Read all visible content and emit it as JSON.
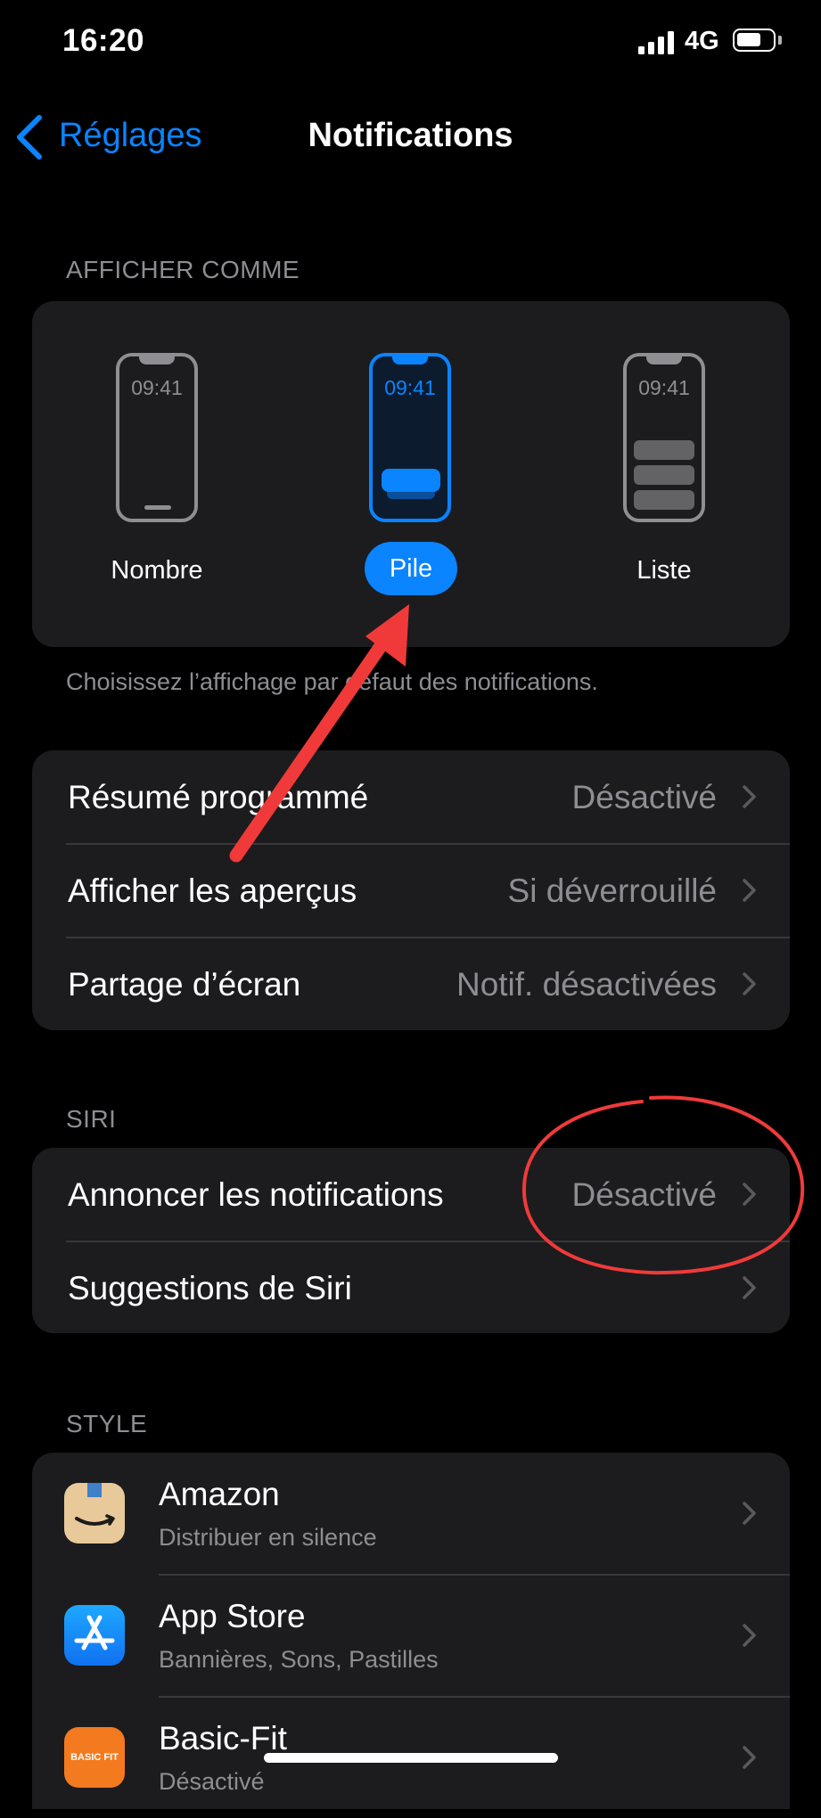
{
  "status": {
    "time": "16:20",
    "network": "4G"
  },
  "nav": {
    "back_label": "Réglages",
    "title": "Notifications"
  },
  "display_section": {
    "header": "AFFICHER COMME",
    "phone_time": "09:41",
    "options": [
      {
        "label": "Nombre",
        "selected": false
      },
      {
        "label": "Pile",
        "selected": true
      },
      {
        "label": "Liste",
        "selected": false
      }
    ],
    "footer": "Choisissez l’affichage par défaut des notifications."
  },
  "settings_rows": [
    {
      "label": "Résumé programmé",
      "value": "Désactivé"
    },
    {
      "label": "Afficher les aperçus",
      "value": "Si déverrouillé"
    },
    {
      "label": "Partage d’écran",
      "value": "Notif. désactivées"
    }
  ],
  "siri_section": {
    "header": "SIRI",
    "rows": [
      {
        "label": "Annoncer les notifications",
        "value": "Désactivé"
      },
      {
        "label": "Suggestions de Siri",
        "value": ""
      }
    ]
  },
  "style_section": {
    "header": "STYLE",
    "apps": [
      {
        "name": "Amazon",
        "subtitle": "Distribuer en silence"
      },
      {
        "name": "App Store",
        "subtitle": "Bannières, Sons, Pastilles"
      },
      {
        "name": "Basic-Fit",
        "subtitle": "Désactivé",
        "icon_text": "BASIC FIT"
      }
    ]
  },
  "colors": {
    "accent": "#0a84ff",
    "background": "#000000",
    "card": "#1c1c1e",
    "secondary_text": "#8d8d93",
    "annotation": "#f03a3a"
  }
}
